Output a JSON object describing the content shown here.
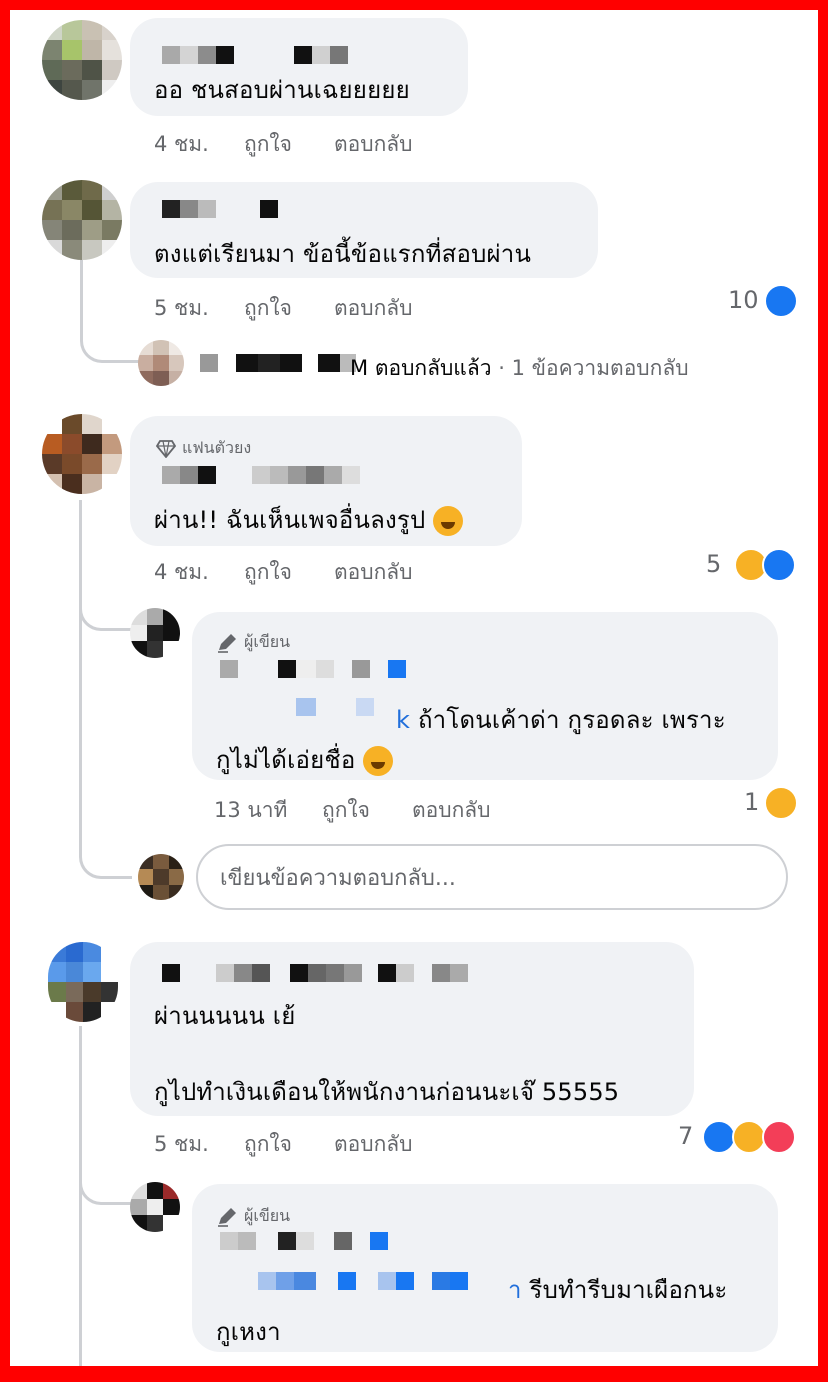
{
  "comments": [
    {
      "text": "ออ ชนสอบผ่านเฉยยยยย",
      "time": "4 ชม.",
      "like": "ถูกใจ",
      "reply": "ตอบกลับ"
    },
    {
      "text": "ตงแต่เรียนมา ข้อนี้ข้อแรกที่สอบผ่าน",
      "time": "5 ชม.",
      "like": "ถูกใจ",
      "reply": "ตอบกลับ",
      "reaction_count": "10",
      "reactions": [
        "like-icon"
      ],
      "replies_summary": {
        "name_tail": "M",
        "replied": "ตอบกลับแล้ว",
        "dot": "·",
        "count_text": "1 ข้อความตอบกลับ"
      }
    },
    {
      "badge": "แฟนตัวยง",
      "badge_icon": "diamond-icon",
      "text": "ผ่าน!! ฉันเห็นเพจอื่นลงรูป",
      "text_emoji": "laughing-tears-emoji",
      "time": "4 ชม.",
      "like": "ถูกใจ",
      "reply": "ตอบกลับ",
      "reaction_count": "5",
      "reactions": [
        "haha-icon",
        "like-icon"
      ],
      "replies": [
        {
          "badge": "ผู้เขียน",
          "badge_icon": "pen-icon",
          "mention_tail": "k",
          "text_line1": "ถ้าโดนเค้าด่า กูรอดละ เพราะ",
          "text_line2": "กูไม่ได้เอ่ยชื่อ",
          "text_emoji": "grinning-squint-emoji",
          "time": "13 นาที",
          "like": "ถูกใจ",
          "reply": "ตอบกลับ",
          "reaction_count": "1",
          "reactions": [
            "haha-icon"
          ]
        }
      ],
      "reply_input": {
        "placeholder": "เขียนข้อความตอบกลับ..."
      }
    },
    {
      "text_line1": "ผ่านนนนน เย้",
      "text_line2": "กูไปทำเงินเดือนให้พนักงานก่อนนะเจ๊ 55555",
      "time": "5 ชม.",
      "like": "ถูกใจ",
      "reply": "ตอบกลับ",
      "reaction_count": "7",
      "reactions": [
        "like-icon",
        "haha-icon",
        "love-icon"
      ],
      "replies": [
        {
          "badge": "ผู้เขียน",
          "badge_icon": "pen-icon",
          "mention_tail": "า",
          "text_line1": "รีบทำรีบมาเผือกนะ",
          "text_line2": "กูเหงา"
        }
      ]
    }
  ],
  "colors": {
    "border": "#ff0000",
    "bubble": "#f0f2f5",
    "meta": "#65676b",
    "like": "#1877f2",
    "haha": "#f7b125",
    "love": "#f33e58",
    "mention": "#216fdb"
  }
}
